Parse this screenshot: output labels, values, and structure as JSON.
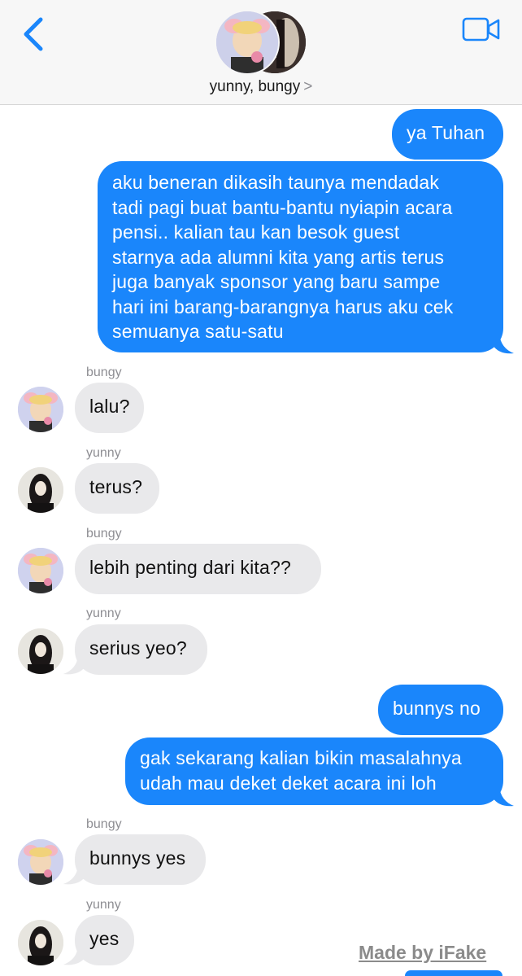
{
  "header": {
    "group_name": "yunny, bungy",
    "chevron": ">",
    "back_icon": "chevron-left-icon",
    "video_icon": "video-camera-icon"
  },
  "colors": {
    "outgoing_bubble": "#1a86fb",
    "incoming_bubble": "#e9e9eb",
    "accent": "#1a86fb"
  },
  "messages": [
    {
      "direction": "out",
      "text": "ya Tuhan"
    },
    {
      "direction": "out",
      "lines": [
        "aku beneran dikasih taunya mendadak",
        "tadi pagi buat bantu-bantu nyiapin acara",
        "pensi.. kalian tau kan besok guest",
        "starnya ada alumni kita yang artis terus",
        "juga banyak sponsor yang baru sampe",
        "hari ini barang-barangnya harus aku cek",
        "semuanya satu-satu"
      ]
    },
    {
      "direction": "in",
      "sender": "bungy",
      "text": "lalu?"
    },
    {
      "direction": "in",
      "sender": "yunny",
      "text": "terus?"
    },
    {
      "direction": "in",
      "sender": "bungy",
      "text": "lebih penting dari kita??"
    },
    {
      "direction": "in",
      "sender": "yunny",
      "text": "serius yeo?"
    },
    {
      "direction": "out",
      "text": "bunnys no"
    },
    {
      "direction": "out",
      "lines": [
        "gak sekarang kalian bikin masalahnya",
        "udah mau deket deket acara ini loh"
      ]
    },
    {
      "direction": "in",
      "sender": "bungy",
      "text": "bunnys yes"
    },
    {
      "direction": "in",
      "sender": "yunny",
      "text": "yes"
    }
  ],
  "watermark": "Made by iFake"
}
